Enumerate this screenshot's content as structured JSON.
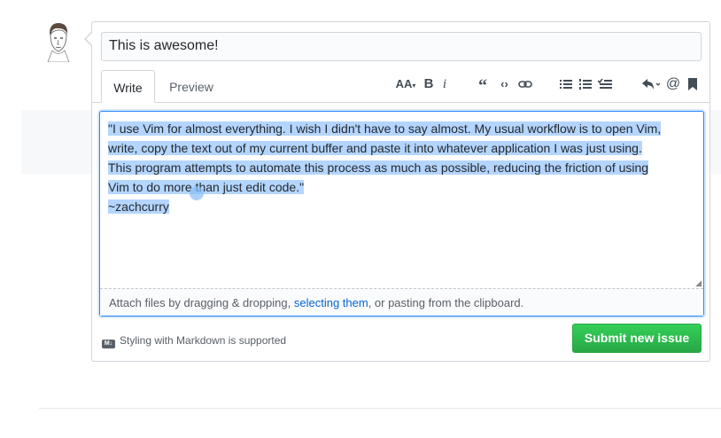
{
  "issue": {
    "title_value": "This is awesome!"
  },
  "tabs": [
    {
      "label": "Write"
    },
    {
      "label": "Preview"
    }
  ],
  "toolbar": {
    "header_glyph": "AA",
    "bold_glyph": "B",
    "italic_glyph": "i",
    "icons": [
      "header-icon",
      "bold-icon",
      "italic-icon",
      "quote-icon",
      "code-icon",
      "link-icon",
      "bulleted-list-icon",
      "numbered-list-icon",
      "task-list-icon",
      "reply-icon",
      "mention-icon",
      "bookmark-icon"
    ]
  },
  "editor": {
    "lines": [
      "\"I use Vim for almost everything. I wish I didn't have to say almost. My usual workflow is to open Vim,",
      "write, copy the text out of my current buffer and paste it into whatever application I was just using.",
      "This program attempts to automate this process as much as possible, reducing the friction of using",
      "Vim to do more than just edit code.\"",
      "~zachcurry"
    ],
    "selection_color": "#b4d5fe"
  },
  "attach": {
    "prefix": "Attach files by dragging & dropping, ",
    "link": "selecting them",
    "suffix": ", or pasting from the clipboard."
  },
  "footer": {
    "markdown_note": "Styling with Markdown is supported",
    "submit_label": "Submit new issue"
  },
  "colors": {
    "accent": "#2188ff",
    "submit_green": "#28a745",
    "link": "#0366d6"
  }
}
